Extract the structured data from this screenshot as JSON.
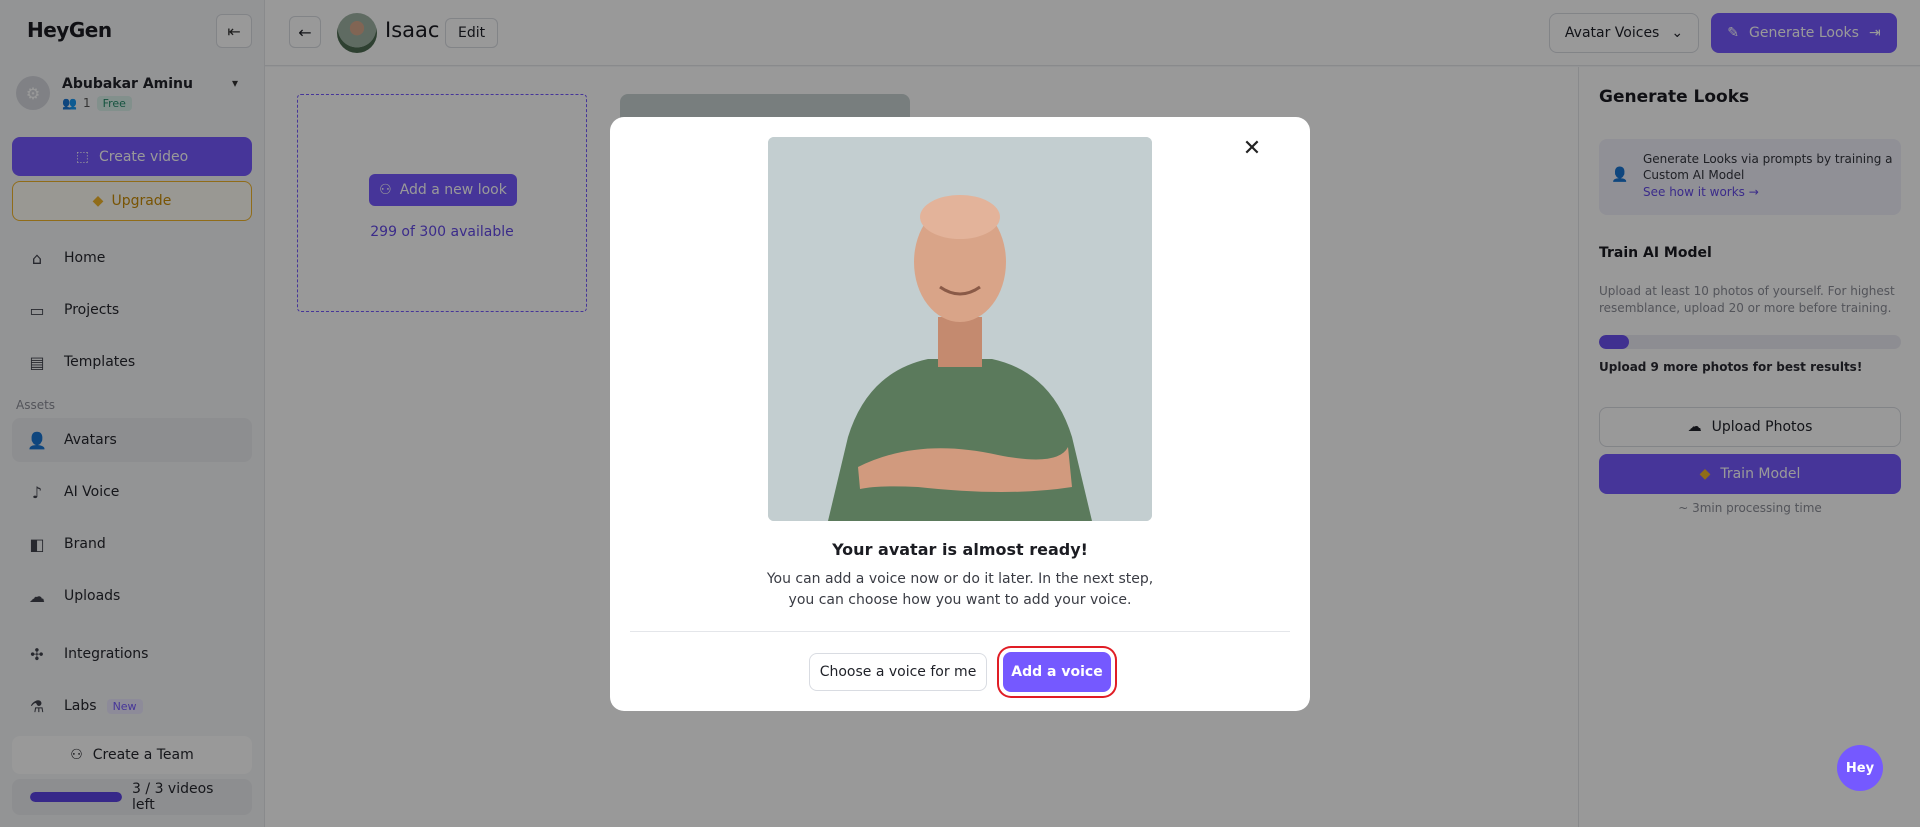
{
  "app": {
    "logo": "HeyGen"
  },
  "user": {
    "name": "Abubakar Aminu",
    "members": "1",
    "plan": "Free"
  },
  "sidebar": {
    "create_video": "Create video",
    "upgrade": "Upgrade",
    "nav": [
      {
        "label": "Home",
        "icon": "home-icon"
      },
      {
        "label": "Projects",
        "icon": "folder-icon"
      },
      {
        "label": "Templates",
        "icon": "templates-icon"
      }
    ],
    "assets_label": "Assets",
    "assets": [
      {
        "label": "Avatars",
        "icon": "avatar-icon",
        "active": true
      },
      {
        "label": "AI Voice",
        "icon": "voice-icon"
      },
      {
        "label": "Brand",
        "icon": "brand-icon"
      },
      {
        "label": "Uploads",
        "icon": "upload-icon"
      },
      {
        "label": "Integrations",
        "icon": "integrations-icon"
      },
      {
        "label": "Labs",
        "icon": "labs-icon",
        "badge": "New"
      }
    ],
    "create_team": "Create a Team",
    "credits": {
      "text": "3 / 3 videos left",
      "fill_fraction": 1.0
    }
  },
  "topbar": {
    "title": "Isaac",
    "edit": "Edit",
    "avatar_voices": "Avatar Voices",
    "generate_looks": "Generate Looks"
  },
  "main": {
    "add_look": "Add a new look",
    "available": "299 of 300 available"
  },
  "right_panel": {
    "title": "Generate Looks",
    "info_text": "Generate Looks via prompts by training a Custom AI Model",
    "info_link": "See how it works →",
    "train_title": "Train AI Model",
    "train_desc": "Upload at least 10 photos of yourself. For highest resemblance, upload 20 or more before training.",
    "progress_fraction": 0.1,
    "hint": "Upload 9 more photos for best results!",
    "upload_btn": "Upload Photos",
    "train_btn": "Train Model",
    "time": "~ 3min processing time"
  },
  "modal": {
    "title": "Your avatar is almost ready!",
    "desc_line1": "You can add a voice now or do it later. In the next step,",
    "desc_line2": "you can choose how you want to add your voice.",
    "choose_btn": "Choose a voice for me",
    "add_btn": "Add a voice"
  },
  "chat": {
    "label": "Hey"
  },
  "colors": {
    "accent": "#7559ff",
    "upgrade": "#f1b52b",
    "highlight": "#e01d25"
  }
}
